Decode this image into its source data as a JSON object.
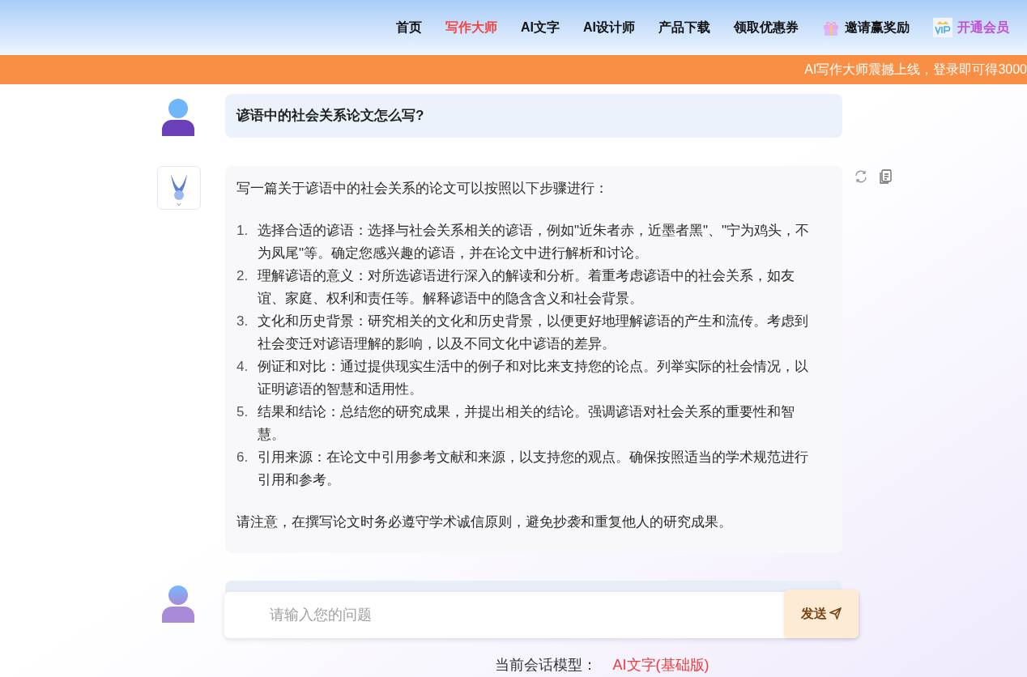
{
  "nav": [
    {
      "label": "首页",
      "kind": "plain",
      "selected": false
    },
    {
      "label": "写作大师",
      "kind": "plain",
      "selected": true
    },
    {
      "label": "AI文字",
      "kind": "plain",
      "selected": false
    },
    {
      "label": "AI设计师",
      "kind": "plain",
      "selected": false
    },
    {
      "label": "产品下载",
      "kind": "plain",
      "selected": false
    },
    {
      "label": "领取优惠券",
      "kind": "plain",
      "selected": false
    },
    {
      "label": "邀请赢奖励",
      "kind": "gift",
      "selected": false
    },
    {
      "label": "开通会员",
      "kind": "vip",
      "selected": false
    }
  ],
  "banner": "AI写作大师震撼上线，登录即可得3000",
  "question": "谚语中的社会关系论文怎么写?",
  "answer": {
    "intro": "写一篇关于谚语中的社会关系的论文可以按照以下步骤进行：",
    "steps": [
      {
        "number": "1.",
        "text": "选择合适的谚语：选择与社会关系相关的谚语，例如\"近朱者赤，近墨者黑\"、\"宁为鸡头，不为凤尾\"等。确定您感兴趣的谚语，并在论文中进行解析和讨论。"
      },
      {
        "number": "2.",
        "text": "理解谚语的意义：对所选谚语进行深入的解读和分析。着重考虑谚语中的社会关系，如友谊、家庭、权利和责任等。解释谚语中的隐含含义和社会背景。"
      },
      {
        "number": "3.",
        "text": "文化和历史背景：研究相关的文化和历史背景，以便更好地理解谚语的产生和流传。考虑到社会变迁对谚语理解的影响，以及不同文化中谚语的差异。"
      },
      {
        "number": "4.",
        "text": "例证和对比：通过提供现实生活中的例子和对比来支持您的论点。列举实际的社会情况，以证明谚语的智慧和适用性。"
      },
      {
        "number": "5.",
        "text": "结果和结论：总结您的研究成果，并提出相关的结论。强调谚语对社会关系的重要性和智慧。"
      },
      {
        "number": "6.",
        "text": "引用来源：在论文中引用参考文献和来源，以支持您的观点。确保按照适当的学术规范进行引用和参考。"
      }
    ],
    "note": "请注意，在撰写论文时务必遵守学术诚信原则，避免抄袭和重复他人的研究成果。"
  },
  "input": {
    "placeholder": "请输入您的问题",
    "send": "发送"
  },
  "model": {
    "label": "当前会话模型：",
    "value": "AI文字(基础版)"
  }
}
